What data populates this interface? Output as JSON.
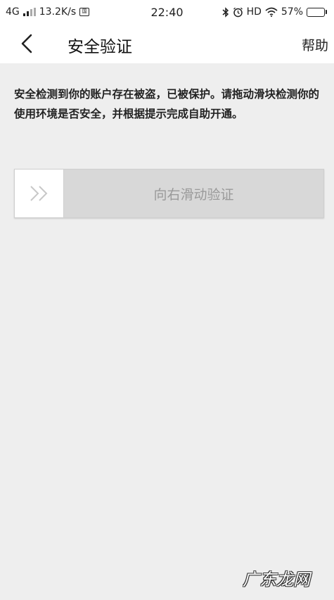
{
  "status_bar": {
    "network": "4G",
    "speed": "13.2K/s",
    "sim_badge": "国",
    "time": "22:40",
    "hd": "HD",
    "battery_percent": "57%",
    "battery_level": 0.57
  },
  "nav": {
    "title": "安全验证",
    "help_label": "帮助"
  },
  "notice": {
    "text": "安全检测到你的账户存在被盗，已被保护。请拖动滑块检测你的使用环境是否安全，并根据提示完成自助开通。"
  },
  "slider": {
    "label": "向右滑动验证"
  },
  "watermark": {
    "text": "广东龙网"
  }
}
